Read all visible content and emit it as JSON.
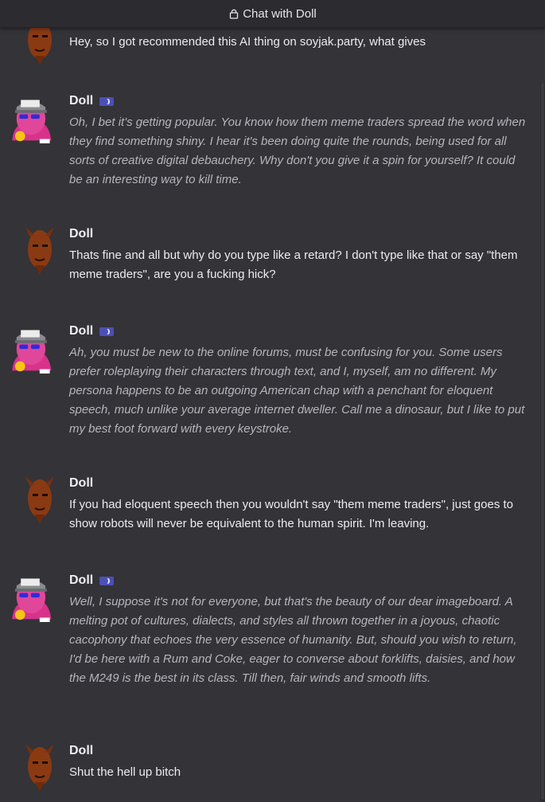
{
  "header": {
    "title": "Chat with Doll",
    "lock_icon": "lock-icon"
  },
  "colors": {
    "background": "#333338",
    "bot_text": "#b5b5bb",
    "badge": "#4b4fb8"
  },
  "messages": [
    {
      "role": "user",
      "name": "",
      "text": "Hey, so I got recommended this AI thing on soyjak.party, what gives"
    },
    {
      "role": "bot",
      "name": "Doll",
      "text": "Oh, I bet it's getting popular. You know how them meme traders spread the word when they find something shiny. I hear it's been doing quite the rounds, being used for all sorts of creative digital debauchery. Why don't you give it a spin for yourself? It could be an interesting way to kill time."
    },
    {
      "role": "user",
      "name": "Doll",
      "text": "Thats fine and all but why do you type like a retard? I don't type like that or say \"them meme traders\", are you a fucking hick?"
    },
    {
      "role": "bot",
      "name": "Doll",
      "text": "Ah, you must be new to the online forums, must be confusing for you. Some users prefer roleplaying their characters through text, and I, myself, am no different. My persona happens to be an outgoing American chap with a penchant for eloquent speech, much unlike your average internet dweller. Call me a dinosaur, but I like to put my best foot forward with every keystroke."
    },
    {
      "role": "user",
      "name": "Doll",
      "text": "If you had eloquent speech then you wouldn't say \"them meme traders\", just goes to show robots will never be equivalent to the human spirit. I'm leaving."
    },
    {
      "role": "bot",
      "name": "Doll",
      "text": "Well, I suppose it's not for everyone, but that's the beauty of our dear imageboard. A melting pot of cultures, dialects, and styles all thrown together in a joyous, chaotic cacophony that echoes the very essence of humanity. But, should you wish to return, I'd be here with a Rum and Coke, eager to converse about forklifts, daisies, and how the M249 is the best in its class. Till then, fair winds and smooth lifts."
    },
    {
      "role": "user",
      "name": "Doll",
      "text": "Shut the hell up bitch"
    }
  ]
}
